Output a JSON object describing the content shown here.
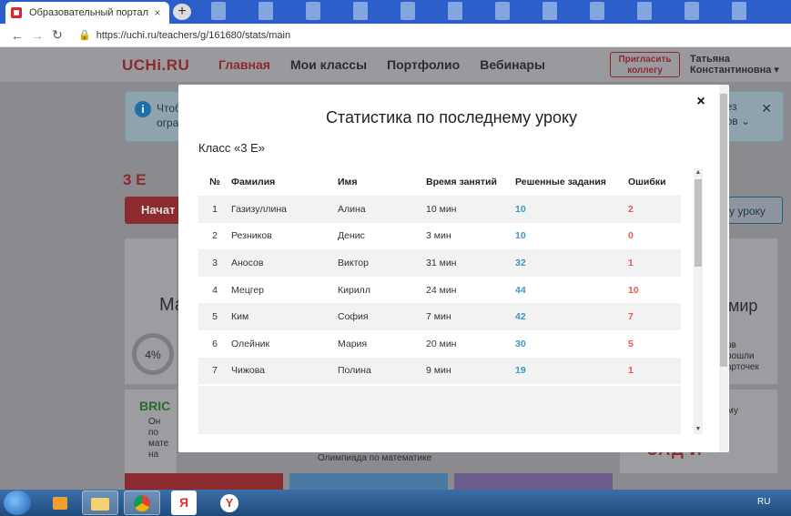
{
  "browser": {
    "tab_title": "Образовательный портал на ба",
    "tab_close": "×",
    "new_tab": "+",
    "url": "https://uchi.ru/teachers/g/161680/stats/main",
    "back": "←",
    "forward": "→",
    "reload": "↻",
    "lock": "🔒"
  },
  "site": {
    "logo": "UCHi.RU",
    "menu": [
      "Главная",
      "Мои классы",
      "Портфолио",
      "Вебинары"
    ],
    "invite_line1": "Пригласить",
    "invite_line2": "коллегу",
    "user_line1": "Татьяна",
    "user_line2": "Константиновна ▾"
  },
  "background": {
    "info_text_line1": "Чтоб",
    "info_text_line2": "огра",
    "info_right_line1": "ез",
    "info_right_line2": "ов ⌄",
    "class_title": "3 Е",
    "start_button": "Начат",
    "lesson_button": "у уроку",
    "card_left_title": "Ма",
    "progress": "4%",
    "card_right_title": "мир",
    "card_right_line1": "ов",
    "card_right_line2": "рошли",
    "card_right_line3": "арточек",
    "bric_title": "BRIC",
    "bric_line1": "Он",
    "bric_line2": "по мате",
    "bric_line3": "на",
    "olymp": "Олимпиада по математике",
    "zadachki": "ЗАД И",
    "card_br_top": "му"
  },
  "modal": {
    "title": "Статистика по последнему уроку",
    "class_label": "Класс «3 Е»",
    "close": "×",
    "columns": [
      "№",
      "Фамилия",
      "Имя",
      "Время занятий",
      "Решенные задания",
      "Ошибки"
    ],
    "rows": [
      {
        "num": "1",
        "last": "Газизуллина",
        "first": "Алина",
        "time": "10 мин",
        "tasks": "10",
        "errors": "2"
      },
      {
        "num": "2",
        "last": "Резников",
        "first": "Денис",
        "time": "3 мин",
        "tasks": "10",
        "errors": "0"
      },
      {
        "num": "3",
        "last": "Аносов",
        "first": "Виктор",
        "time": "31 мин",
        "tasks": "32",
        "errors": "1"
      },
      {
        "num": "4",
        "last": "Мецгер",
        "first": "Кирилл",
        "time": "24 мин",
        "tasks": "44",
        "errors": "10"
      },
      {
        "num": "5",
        "last": "Ким",
        "first": "София",
        "time": "7 мин",
        "tasks": "42",
        "errors": "7"
      },
      {
        "num": "6",
        "last": "Олейник",
        "first": "Мария",
        "time": "20 мин",
        "tasks": "30",
        "errors": "5"
      },
      {
        "num": "7",
        "last": "Чижова",
        "first": "Полина",
        "time": "9 мин",
        "tasks": "19",
        "errors": "1"
      }
    ]
  },
  "taskbar": {
    "yandex": "Я",
    "yandex_browser": "Y",
    "language": "RU"
  }
}
